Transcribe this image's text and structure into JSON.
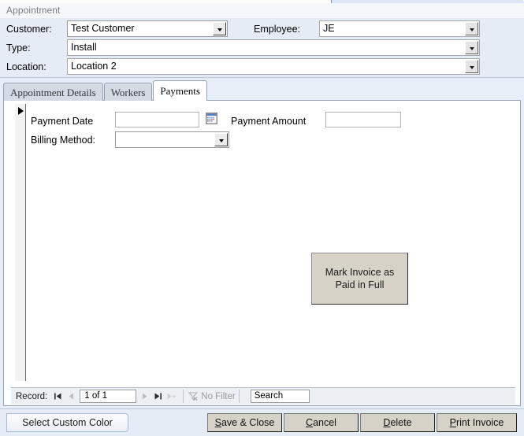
{
  "window": {
    "document_tab": "Appointment"
  },
  "header": {
    "title": "Appointment",
    "fields": [
      {
        "label": "Customer:",
        "value": "Test Customer",
        "control": "combobox"
      },
      {
        "label": "Employee:",
        "value": "JE",
        "control": "combobox"
      },
      {
        "label": "Type:",
        "value": "Install",
        "control": "combobox"
      },
      {
        "label": "Location:",
        "value": "Location 2",
        "control": "combobox"
      }
    ]
  },
  "tabs": [
    {
      "label": "Appointment Details",
      "active": false
    },
    {
      "label": "Workers",
      "active": false
    },
    {
      "label": "Payments",
      "active": true
    }
  ],
  "payments_page": {
    "payment_date": {
      "label": "Payment Date",
      "value": "",
      "picker_icon": "calendar-icon"
    },
    "payment_amount": {
      "label": "Payment Amount",
      "value": ""
    },
    "billing_method": {
      "label": "Billing Method:",
      "value": ""
    },
    "mark_paid_button": {
      "line1": "Mark Invoice as",
      "line2": "Paid in Full"
    }
  },
  "record_nav": {
    "label": "Record:",
    "first_icon": "first-record-icon",
    "prev_icon": "previous-record-icon",
    "position": "1 of 1",
    "next_icon": "next-record-icon",
    "last_icon": "last-record-icon",
    "new_icon": "new-record-icon",
    "filter_icon": "filter-icon",
    "filter_label": "No Filter",
    "search_placeholder": "Search",
    "search_value": "Search"
  },
  "command_bar": {
    "select_custom_color": "Select Custom Color",
    "save_close": {
      "pre": "",
      "accel": "S",
      "post": "ave & Close"
    },
    "cancel": {
      "pre": "",
      "accel": "C",
      "post": "ancel"
    },
    "delete": {
      "pre": "",
      "accel": "D",
      "post": "elete"
    },
    "print_invoice": {
      "pre": "",
      "accel": "P",
      "post": "rint Invoice"
    }
  },
  "colors": {
    "header_band": "#e6ecf5",
    "tab_inactive": "#d4dae3",
    "tab_active": "#ffffff",
    "button_face": "#d6d2c8",
    "accent_blue": "#dce6f4"
  }
}
